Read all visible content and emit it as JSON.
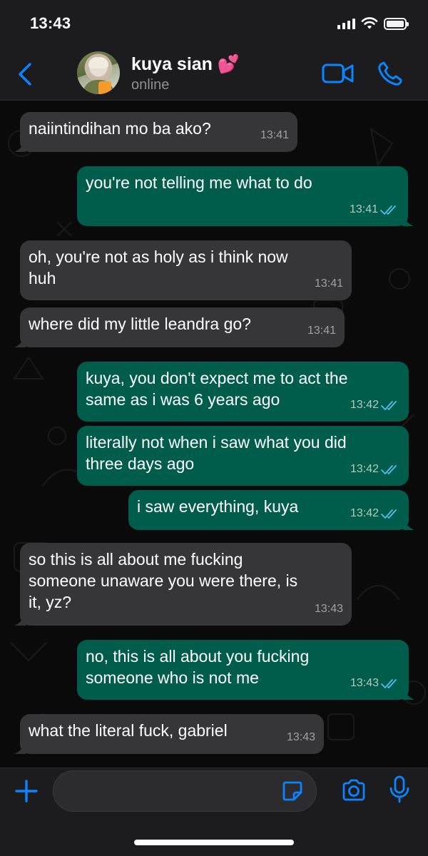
{
  "status_bar": {
    "time": "13:43",
    "icons": [
      "signal-icon",
      "wifi-icon",
      "battery-icon"
    ]
  },
  "header": {
    "back_icon": "chevron-left-icon",
    "contact_name": "kuya sian 💕",
    "contact_status": "online",
    "video_icon": "video-camera-icon",
    "call_icon": "phone-icon"
  },
  "messages": [
    {
      "direction": "in",
      "text": "naiintindihan mo ba ako?",
      "time": "13:41"
    },
    {
      "direction": "out",
      "text": "you're not telling me what to do",
      "time": "13:41",
      "read": true
    },
    {
      "direction": "in",
      "text": "oh, you're not as holy as i think now\nhuh",
      "time": "13:41"
    },
    {
      "direction": "in",
      "text": "where did my little leandra go?",
      "time": "13:41"
    },
    {
      "direction": "out",
      "text": "kuya, you don't expect me to act the\nsame as i was 6 years ago",
      "time": "13:42",
      "read": true
    },
    {
      "direction": "out",
      "text": "literally not when i saw what you did\nthree days ago",
      "time": "13:42",
      "read": true
    },
    {
      "direction": "out",
      "text": "i saw everything, kuya",
      "time": "13:42",
      "read": true
    },
    {
      "direction": "in",
      "text": "so this is all about me fucking\nsomeone unaware you were there, is\nit, yz?",
      "time": "13:43"
    },
    {
      "direction": "out",
      "text": "no, this is all about you fucking\nsomeone who is not me",
      "time": "13:43",
      "read": true
    },
    {
      "direction": "in",
      "text": "what the literal fuck, gabriel",
      "time": "13:43"
    }
  ],
  "input_bar": {
    "plus_icon": "plus-icon",
    "input_value": "",
    "input_placeholder": "",
    "sticker_icon": "sticker-icon",
    "camera_icon": "camera-icon",
    "mic_icon": "microphone-icon"
  },
  "colors": {
    "accent": "#0a84ff",
    "incoming_bubble": "#363638",
    "outgoing_bubble": "#005c4b",
    "read_ticks": "#53bdeb",
    "bar_background": "#1c1c1e"
  }
}
